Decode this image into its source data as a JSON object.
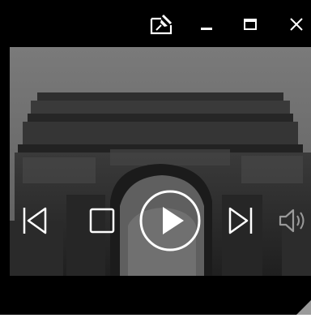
{
  "window": {
    "title_buttons": [
      {
        "icon": "pin-icon"
      },
      {
        "icon": "minimize-icon"
      },
      {
        "icon": "maximize-icon"
      },
      {
        "icon": "close-icon"
      }
    ]
  },
  "controls": {
    "previous_icon": "skip-previous-icon",
    "stop_icon": "stop-icon",
    "play_icon": "play-icon",
    "next_icon": "skip-next-icon",
    "volume_icon": "volume-icon",
    "volume_enabled": false
  },
  "colors": {
    "chrome": "#000000",
    "icon": "#ffffff",
    "icon_disabled": "#9a9a9a",
    "sky": "#6e6e6e",
    "stone": "#2b2b2b"
  }
}
